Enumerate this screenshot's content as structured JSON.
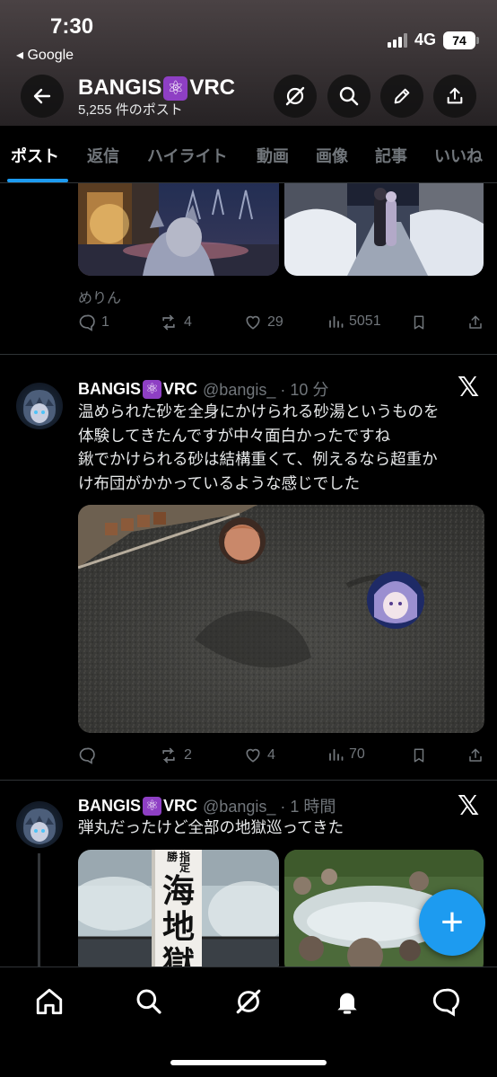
{
  "status_bar": {
    "time": "7:30",
    "back_app": "◂ Google",
    "network": "4G",
    "battery": "74"
  },
  "header": {
    "account_name_prefix": "BANGIS",
    "account_emoji": "⚛",
    "account_name_suffix": "VRC",
    "post_count": "5,255 件のポスト",
    "buttons": [
      "back-arrow-icon",
      "grok-icon",
      "search-icon",
      "edit-icon",
      "share-icon"
    ]
  },
  "tabs": [
    {
      "label": "ポスト",
      "active": true
    },
    {
      "label": "返信"
    },
    {
      "label": "ハイライト"
    },
    {
      "label": "動画"
    },
    {
      "label": "画像"
    },
    {
      "label": "記事"
    },
    {
      "label": "いいね"
    }
  ],
  "posts": [
    {
      "media_caption": "めりん",
      "stats": {
        "replies": "1",
        "reposts": "4",
        "likes": "29",
        "views": "5051"
      }
    },
    {
      "author_name_prefix": "BANGIS",
      "author_name_suffix": "VRC",
      "handle_time": "@bangis_ · 10 分",
      "text_lines": [
        "温められた砂を全身にかけられる砂湯というものを",
        "体験してきたんですが中々面白かったですね",
        "鍬でかけられる砂は結構重くて、例えるなら超重か",
        "け布団がかかっているような感じでした"
      ],
      "stats": {
        "replies": "",
        "reposts": "2",
        "likes": "4",
        "views": "70"
      }
    },
    {
      "author_name_prefix": "BANGIS",
      "author_name_suffix": "VRC",
      "handle_time": "@bangis_ · 1 時間",
      "text_lines": [
        "弾丸だったけど全部の地獄巡ってきた"
      ],
      "sign_text": [
        "指",
        "定",
        "勝",
        "海",
        "地",
        "獄"
      ]
    }
  ],
  "bottom_nav": [
    "home-icon",
    "search-icon",
    "grok-icon",
    "notifications-icon",
    "messages-icon"
  ],
  "fab_label": "+",
  "colors": {
    "accent": "#1d9bf0",
    "background": "#000000",
    "muted": "#71767b",
    "atom_badge": "#8e3fc4"
  }
}
